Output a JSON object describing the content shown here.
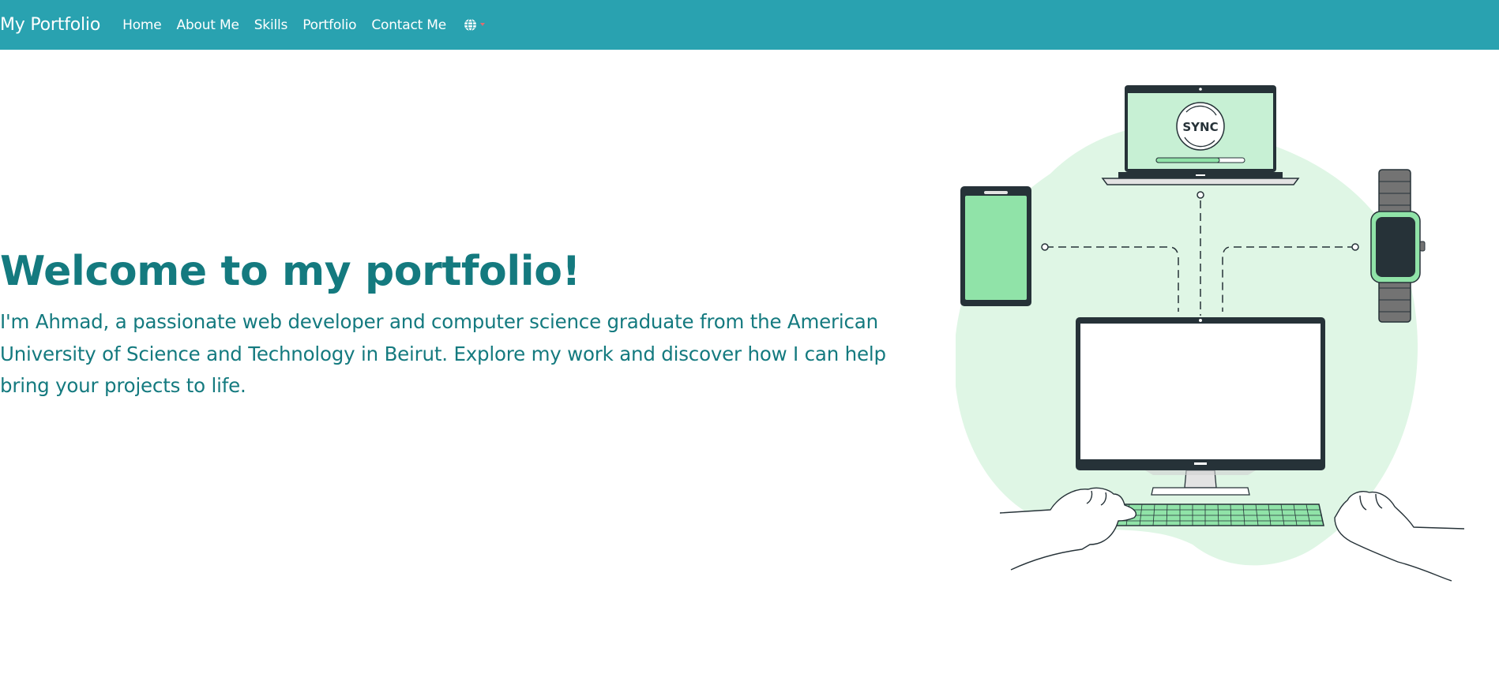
{
  "navbar": {
    "brand": "My Portfolio",
    "links": [
      {
        "label": "Home"
      },
      {
        "label": "About Me"
      },
      {
        "label": "Skills"
      },
      {
        "label": "Portfolio"
      },
      {
        "label": "Contact Me"
      }
    ],
    "language_icon": "globe-icon",
    "bg_color": "#29a2b0"
  },
  "hero": {
    "title": "Welcome to my portfolio!",
    "text": "I'm Ahmad, a passionate web developer and computer science graduate from the American University of Science and Technology in Beirut. Explore my work and discover how I can help bring your projects to life.",
    "text_color": "#147a7f"
  },
  "illustration": {
    "laptop_screen_text": "SYNC",
    "accent_color": "#90e3a8",
    "blob_color": "#dff6e5",
    "dark_color": "#263238"
  }
}
